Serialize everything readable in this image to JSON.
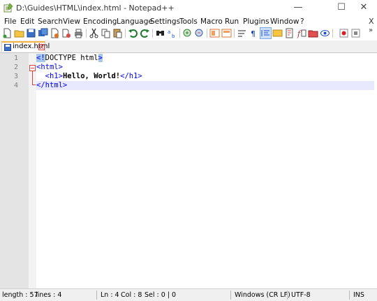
{
  "window": {
    "title": "D:\\Guides\\HTML\\index.html - Notepad++",
    "minimize": "—",
    "maximize": "☐",
    "close": "✕"
  },
  "menu": {
    "items": [
      "File",
      "Edit",
      "Search",
      "View",
      "Encoding",
      "Language",
      "Settings",
      "Tools",
      "Macro",
      "Run",
      "Plugins",
      "Window",
      "?"
    ],
    "close_doc": "X"
  },
  "toolbar": {
    "overflow": "»",
    "icons": [
      "new-file-icon",
      "open-file-icon",
      "save-icon",
      "save-all-icon",
      "close-icon",
      "close-all-icon",
      "print-icon",
      "cut-icon",
      "copy-icon",
      "paste-icon",
      "undo-icon",
      "redo-icon",
      "find-icon",
      "replace-icon",
      "zoom-in-icon",
      "zoom-out-icon",
      "sync-vertical-icon",
      "sync-horizontal-icon",
      "word-wrap-icon",
      "show-all-chars-icon",
      "indent-guide-icon",
      "define-language-icon",
      "doc-map-icon",
      "function-list-icon",
      "folder-as-workspace-icon",
      "monitoring-icon",
      "record-macro-icon",
      "stop-macro-icon"
    ]
  },
  "tab": {
    "label": "index.html"
  },
  "editor": {
    "line_numbers": [
      "1",
      "2",
      "3",
      "4"
    ],
    "lines": [
      {
        "parts": [
          {
            "t": "<!",
            "c": "tag hl"
          },
          {
            "t": "DOCTYPE html",
            "c": ""
          },
          {
            "t": ">",
            "c": "tag hl"
          }
        ]
      },
      {
        "parts": [
          {
            "t": "<html>",
            "c": "tag"
          }
        ]
      },
      {
        "parts": [
          {
            "t": "  ",
            "c": ""
          },
          {
            "t": "<h1>",
            "c": "tag"
          },
          {
            "t": "Hello, World!",
            "c": "bold"
          },
          {
            "t": "</h1>",
            "c": "tag"
          }
        ]
      },
      {
        "parts": [
          {
            "t": "</html>",
            "c": "tag"
          }
        ]
      }
    ]
  },
  "status": {
    "length": "length : 57",
    "lines": "lines : 4",
    "ln": "Ln : 4",
    "col": "Col : 8",
    "sel": "Sel : 0 | 0",
    "eol": "Windows (CR LF)",
    "encoding": "UTF-8",
    "mode": "INS"
  },
  "colors": {
    "accent": "#f5b343",
    "tag": "#0000ff",
    "current_line": "#e8e8ff",
    "gutter": "#e4e4e4"
  }
}
